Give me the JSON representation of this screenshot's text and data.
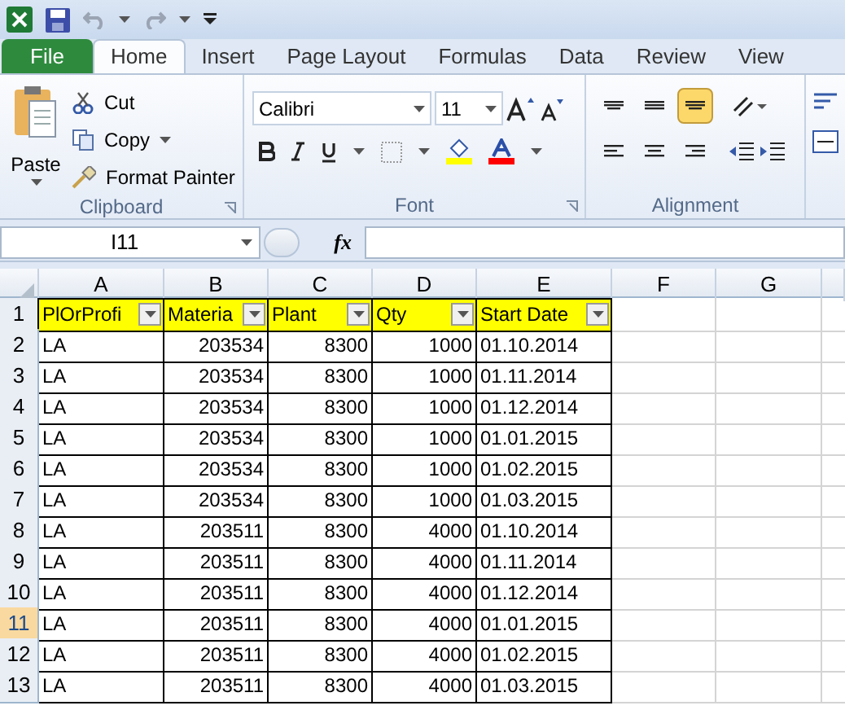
{
  "tabs": [
    {
      "label": "File",
      "kind": "file",
      "selected": false
    },
    {
      "label": "Home",
      "kind": "tab",
      "selected": true
    },
    {
      "label": "Insert",
      "kind": "tab",
      "selected": false
    },
    {
      "label": "Page Layout",
      "kind": "tab",
      "selected": false
    },
    {
      "label": "Formulas",
      "kind": "tab",
      "selected": false
    },
    {
      "label": "Data",
      "kind": "tab",
      "selected": false
    },
    {
      "label": "Review",
      "kind": "tab",
      "selected": false
    },
    {
      "label": "View",
      "kind": "tab",
      "selected": false
    }
  ],
  "clipboard": {
    "paste": "Paste",
    "cut": "Cut",
    "copy": "Copy",
    "format_painter": "Format Painter",
    "group": "Clipboard"
  },
  "font": {
    "name": "Calibri",
    "size": "11",
    "group": "Font"
  },
  "alignment": {
    "group": "Alignment",
    "vertical": [
      {
        "selected": false
      },
      {
        "selected": false
      },
      {
        "selected": true
      }
    ]
  },
  "formula_bar": {
    "name_box": "I11",
    "fx": "fx"
  },
  "columns": [
    {
      "label": "A",
      "selected": false
    },
    {
      "label": "B",
      "selected": false
    },
    {
      "label": "C",
      "selected": false
    },
    {
      "label": "D",
      "selected": false
    },
    {
      "label": "E",
      "selected": false
    },
    {
      "label": "F",
      "selected": false
    },
    {
      "label": "G",
      "selected": false
    }
  ],
  "rows": [
    {
      "header": "1",
      "kind": "header",
      "selected": false,
      "cells": [
        "PlOrProfi",
        "Materia",
        "Plant",
        "Qty",
        "Start Date"
      ]
    },
    {
      "header": "2",
      "kind": "data",
      "selected": false,
      "cells": [
        "LA",
        "203534",
        "8300",
        "1000",
        "01.10.2014"
      ]
    },
    {
      "header": "3",
      "kind": "data",
      "selected": false,
      "cells": [
        "LA",
        "203534",
        "8300",
        "1000",
        "01.11.2014"
      ]
    },
    {
      "header": "4",
      "kind": "data",
      "selected": false,
      "cells": [
        "LA",
        "203534",
        "8300",
        "1000",
        "01.12.2014"
      ]
    },
    {
      "header": "5",
      "kind": "data",
      "selected": false,
      "cells": [
        "LA",
        "203534",
        "8300",
        "1000",
        "01.01.2015"
      ]
    },
    {
      "header": "6",
      "kind": "data",
      "selected": false,
      "cells": [
        "LA",
        "203534",
        "8300",
        "1000",
        "01.02.2015"
      ]
    },
    {
      "header": "7",
      "kind": "data",
      "selected": false,
      "cells": [
        "LA",
        "203534",
        "8300",
        "1000",
        "01.03.2015"
      ]
    },
    {
      "header": "8",
      "kind": "data",
      "selected": false,
      "cells": [
        "LA",
        "203511",
        "8300",
        "4000",
        "01.10.2014"
      ]
    },
    {
      "header": "9",
      "kind": "data",
      "selected": false,
      "cells": [
        "LA",
        "203511",
        "8300",
        "4000",
        "01.11.2014"
      ]
    },
    {
      "header": "10",
      "kind": "data",
      "selected": false,
      "cells": [
        "LA",
        "203511",
        "8300",
        "4000",
        "01.12.2014"
      ]
    },
    {
      "header": "11",
      "kind": "data",
      "selected": true,
      "cells": [
        "LA",
        "203511",
        "8300",
        "4000",
        "01.01.2015"
      ]
    },
    {
      "header": "12",
      "kind": "data",
      "selected": false,
      "cells": [
        "LA",
        "203511",
        "8300",
        "4000",
        "01.02.2015"
      ]
    },
    {
      "header": "13",
      "kind": "data",
      "selected": false,
      "cells": [
        "LA",
        "203511",
        "8300",
        "4000",
        "01.03.2015"
      ]
    }
  ]
}
